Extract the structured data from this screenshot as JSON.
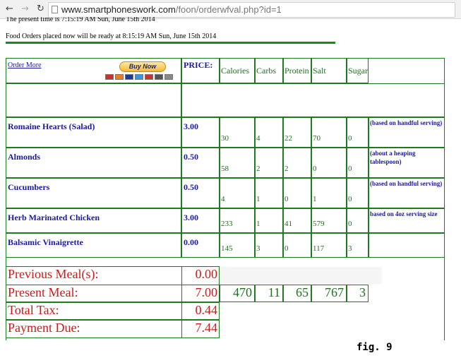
{
  "browser": {
    "url_host": "www.smartphoneswork.com",
    "url_path": "/foon/orderwfval.php?id=1"
  },
  "messages": {
    "present_time": "The present time is 7:15:19 AM Sun, June 15th 2014",
    "ready_time": "Food Orders placed now will be ready at 8:15:19 AM Sun, June 15th 2014"
  },
  "header": {
    "order_more": "Order More",
    "buy_now": "Buy Now",
    "price": "PRICE:",
    "columns": [
      "Calories",
      "Carbs",
      "Protein",
      "Salt",
      "Sugar"
    ]
  },
  "items": [
    {
      "name": "Romaine Hearts (Salad)",
      "price": "3.00",
      "calories": "30",
      "carbs": "4",
      "protein": "22",
      "salt": "70",
      "sugar": "0",
      "note": "(based on handful serving)"
    },
    {
      "name": "Almonds",
      "price": "0.50",
      "calories": "58",
      "carbs": "2",
      "protein": "2",
      "salt": "0",
      "sugar": "0",
      "note": "(about a heaping tablespoon)"
    },
    {
      "name": "Cucumbers",
      "price": "0.50",
      "calories": "4",
      "carbs": "1",
      "protein": "0",
      "salt": "1",
      "sugar": "0",
      "note": "(based on handful serving)"
    },
    {
      "name": "Herb Marinated Chicken",
      "price": "3.00",
      "calories": "233",
      "carbs": "1",
      "protein": "41",
      "salt": "579",
      "sugar": "0",
      "note": "based on 4oz serving size"
    },
    {
      "name": "Balsamic Vinaigrette",
      "price": "0.00",
      "calories": "145",
      "carbs": "3",
      "protein": "0",
      "salt": "117",
      "sugar": "3",
      "note": ""
    }
  ],
  "summary": {
    "previous_label": "Previous Meal(s):",
    "previous_value": "0.00",
    "present_label": "Present Meal:",
    "present_value": "7.00",
    "totals": {
      "calories": "470",
      "carbs": "11",
      "protein": "65",
      "salt": "767",
      "sugar": "3"
    },
    "tax_label": "Total Tax:",
    "tax_value": "0.44",
    "due_label": "Payment Due:",
    "due_value": "7.44"
  },
  "caption": "fig. 9",
  "colors": {
    "border_green": "#1f7a1f",
    "link_blue": "#1a1aa0",
    "summary_red": "#cc1a1a"
  }
}
